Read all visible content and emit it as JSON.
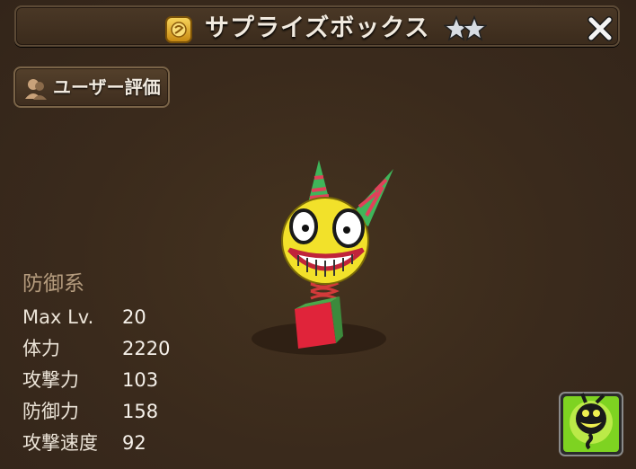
{
  "window": {
    "title": "サプライズボックス",
    "star_count": 2,
    "close_label": "✕"
  },
  "user_rating": {
    "label": "ユーザー評価"
  },
  "monster": {
    "category": "防御系",
    "stats": [
      {
        "label": "Max Lv.",
        "value": "20"
      },
      {
        "label": "体力",
        "value": "2220"
      },
      {
        "label": "攻撃力",
        "value": "103"
      },
      {
        "label": "防御力",
        "value": "158"
      },
      {
        "label": "攻撃速度",
        "value": "92"
      }
    ]
  },
  "colors": {
    "background": "#3a2a1c",
    "title_icon": "#e7b53a",
    "skill_glow": "#7ed321",
    "category_text": "#b59c7e"
  },
  "icons": {
    "title": "gold-coin-icon",
    "rating": "user-silhouette-icon",
    "close": "close-icon",
    "skill": "surprise-box-skill-icon"
  }
}
